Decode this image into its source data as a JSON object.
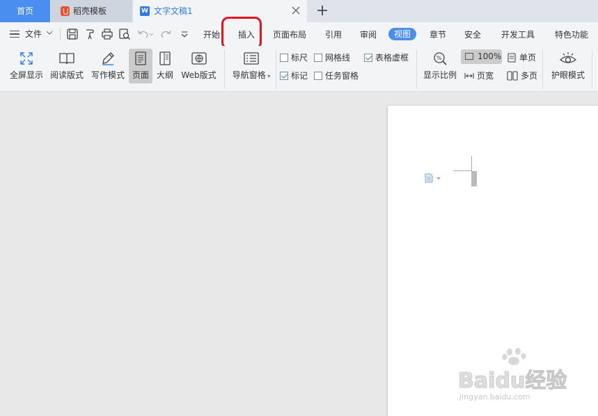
{
  "tabs": {
    "home": "首页",
    "template": "稻壳模板",
    "document": "文字文稿1",
    "document_icon": "W"
  },
  "menu": {
    "file": "文件",
    "items": [
      "开始",
      "插入",
      "页面布局",
      "引用",
      "审阅",
      "视图",
      "章节",
      "安全",
      "开发工具",
      "特色功能"
    ],
    "active": "视图",
    "highlighted": "插入"
  },
  "ribbon": {
    "fullscreen": "全屏显示",
    "read_mode": "阅读版式",
    "write_mode": "写作模式",
    "page_view": "页面",
    "outline": "大纲",
    "web_layout": "Web版式",
    "nav_pane": "导航窗格",
    "checks": {
      "ruler": {
        "label": "标尺",
        "checked": false
      },
      "gridlines": {
        "label": "网格线",
        "checked": false
      },
      "table_gridlines": {
        "label": "表格虚框",
        "checked": true
      },
      "marks": {
        "label": "标记",
        "checked": true
      },
      "task_pane": {
        "label": "任务窗格",
        "checked": false
      }
    },
    "zoom_ratio": "显示比例",
    "zoom_value": "100%",
    "page_width": "页宽",
    "single_page": "单页",
    "multi_page": "多页",
    "eye_protect": "护眼模式"
  },
  "watermark": {
    "main": "Baidu经验",
    "sub": "jingyan.baidu.com"
  },
  "colors": {
    "accent": "#4a8ff0",
    "highlight_ring": "#e5141c",
    "tab_bar": "#dfe3ea",
    "canvas": "#e8e8e8"
  }
}
